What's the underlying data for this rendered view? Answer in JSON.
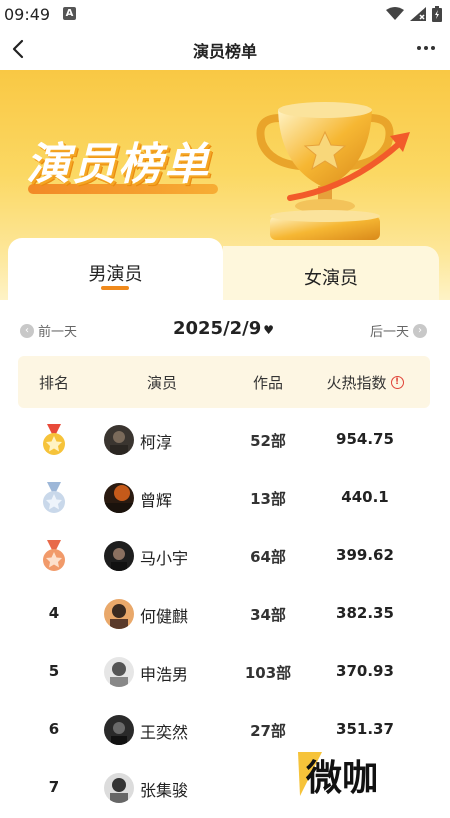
{
  "status": {
    "time": "09:49",
    "notif": "A"
  },
  "nav": {
    "title": "演员榜单"
  },
  "hero": {
    "title": "演员榜单"
  },
  "tabs": [
    {
      "label": "男演员"
    },
    {
      "label": "女演员"
    }
  ],
  "date": {
    "prev": "前一天",
    "current": "2025/2/9",
    "heart": "♥",
    "next": "后一天"
  },
  "table": {
    "headers": {
      "rank": "排名",
      "actor": "演员",
      "works": "作品",
      "heat": "火热指数"
    },
    "info_icon": "!",
    "rows": [
      {
        "rank": "1",
        "name": "柯淳",
        "works": "52部",
        "heat": "954.75",
        "medal": "gold"
      },
      {
        "rank": "2",
        "name": "曾辉",
        "works": "13部",
        "heat": "440.1",
        "medal": "silver"
      },
      {
        "rank": "3",
        "name": "马小宇",
        "works": "64部",
        "heat": "399.62",
        "medal": "bronze"
      },
      {
        "rank": "4",
        "name": "何健麒",
        "works": "34部",
        "heat": "382.35"
      },
      {
        "rank": "5",
        "name": "申浩男",
        "works": "103部",
        "heat": "370.93"
      },
      {
        "rank": "6",
        "name": "王奕然",
        "works": "27部",
        "heat": "351.37"
      },
      {
        "rank": "7",
        "name": "张集骏",
        "works": "",
        "heat": ""
      }
    ]
  },
  "watermark": "微咖",
  "colors": {
    "accent": "#f08a1c",
    "hero_top": "#f9c844",
    "header_bg": "#fdf6e3",
    "info_red": "#e0453a"
  }
}
